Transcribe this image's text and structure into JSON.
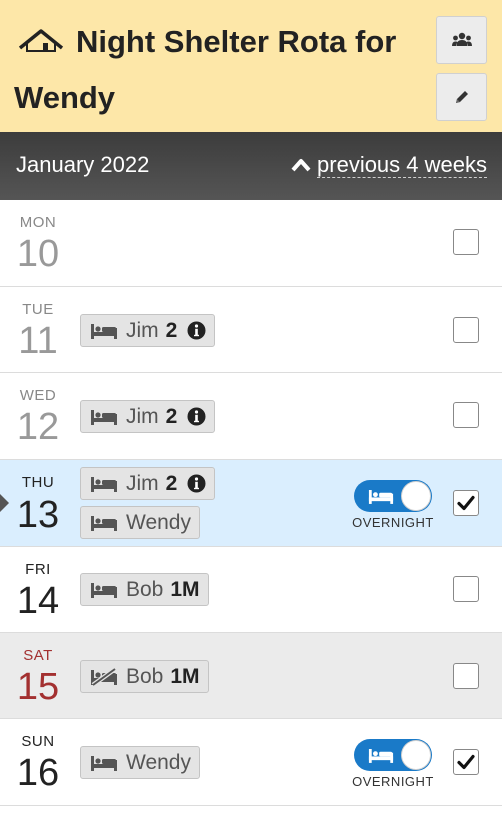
{
  "header": {
    "title": "Night Shelter Rota for Wendy",
    "icons": {
      "home": "house-icon",
      "users": "users-icon",
      "edit": "pencil-icon"
    }
  },
  "month_bar": {
    "month": "January 2022",
    "previous_link": "previous 4 weeks"
  },
  "days": [
    {
      "name": "MON",
      "num": "10",
      "chips": [],
      "checked": false,
      "overnight": false
    },
    {
      "name": "TUE",
      "num": "11",
      "chips": [
        {
          "person": "Jim",
          "extra": "2",
          "info": true
        }
      ],
      "checked": false,
      "overnight": false
    },
    {
      "name": "WED",
      "num": "12",
      "chips": [
        {
          "person": "Jim",
          "extra": "2",
          "info": true
        }
      ],
      "checked": false,
      "overnight": false
    },
    {
      "name": "THU",
      "num": "13",
      "chips": [
        {
          "person": "Jim",
          "extra": "2",
          "info": true
        },
        {
          "person": "Wendy"
        }
      ],
      "checked": true,
      "overnight": true,
      "overnight_label": "OVERNIGHT"
    },
    {
      "name": "FRI",
      "num": "14",
      "chips": [
        {
          "person": "Bob",
          "extra": "1M"
        }
      ],
      "checked": false,
      "overnight": false
    },
    {
      "name": "SAT",
      "num": "15",
      "chips": [
        {
          "person": "Bob",
          "extra": "1M",
          "bed_struck": true
        }
      ],
      "checked": false,
      "overnight": false
    },
    {
      "name": "SUN",
      "num": "16",
      "chips": [
        {
          "person": "Wendy"
        }
      ],
      "checked": true,
      "overnight": true,
      "overnight_label": "OVERNIGHT"
    }
  ],
  "colors": {
    "header_bg": "#fde7a8",
    "month_bar_bg": "#4a4a4a",
    "today_bg": "#daeefe",
    "weekend_bg": "#ebebeb",
    "toggle_on": "#1a7ac8",
    "saturday_red": "#a33030"
  }
}
